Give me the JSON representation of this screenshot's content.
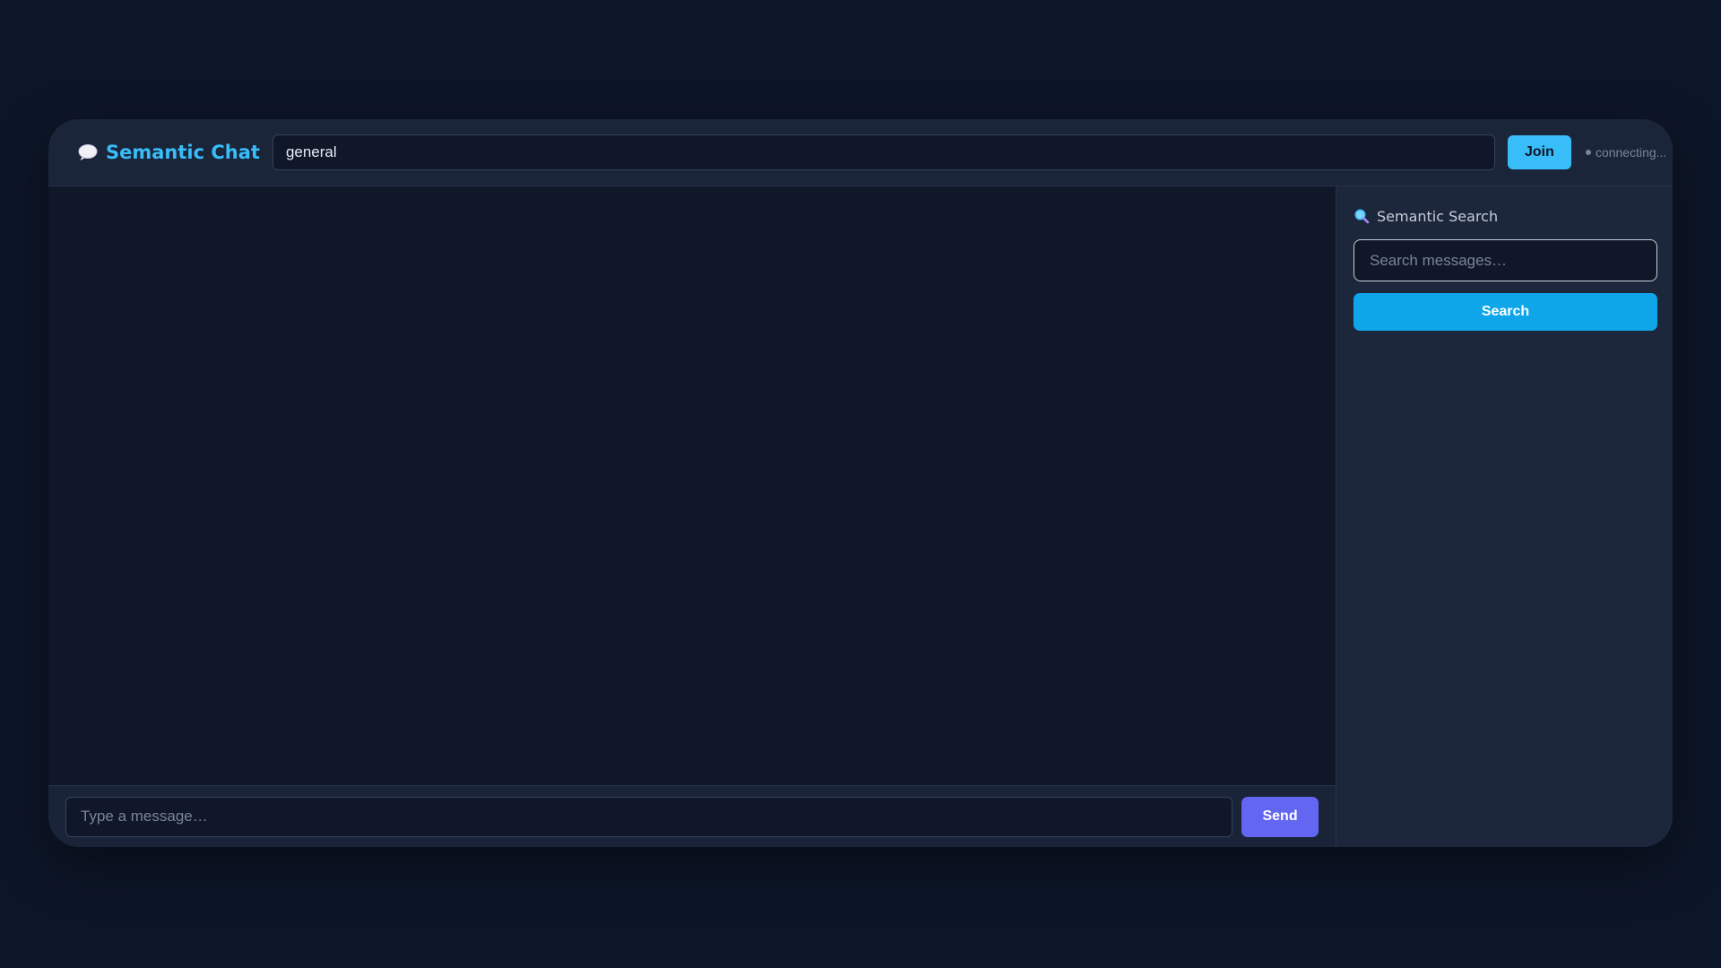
{
  "header": {
    "brand_icon": "speech-bubble-icon",
    "brand_title": "Semantic Chat",
    "room_value": "general",
    "join_label": "Join",
    "status_text": "connecting..."
  },
  "composer": {
    "placeholder": "Type a message…",
    "send_label": "Send"
  },
  "sidebar": {
    "title_icon": "magnifier-icon",
    "title": "Semantic Search",
    "search_placeholder": "Search messages…",
    "search_button_label": "Search"
  },
  "colors": {
    "page_background": "#0d1628",
    "panel_background": "#1a2438",
    "accent_blue": "#38bdf8",
    "search_button": "#0ea5e9",
    "send_button": "#6366f1",
    "status_gray": "#7b8597"
  }
}
